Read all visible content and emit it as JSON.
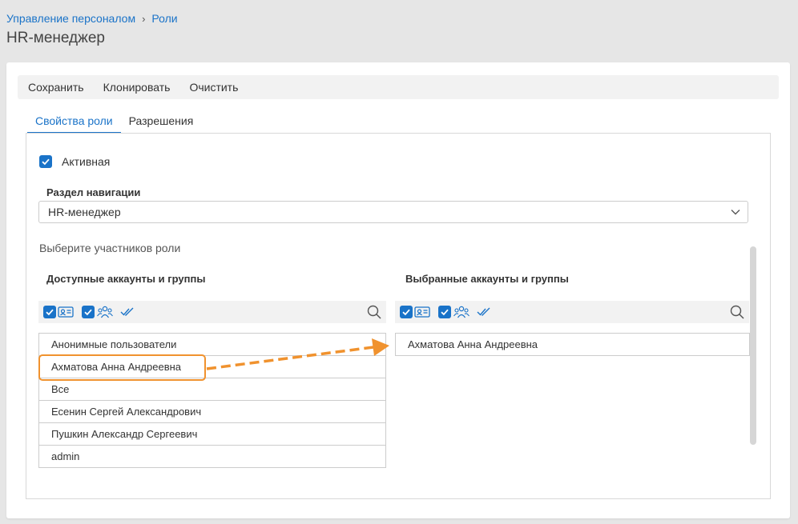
{
  "breadcrumb": {
    "parent": "Управление персоналом",
    "current": "Роли"
  },
  "page_title": "HR-менеджер",
  "toolbar": {
    "save": "Сохранить",
    "clone": "Клонировать",
    "clear": "Очистить"
  },
  "tabs": [
    {
      "label": "Свойства роли",
      "active": true
    },
    {
      "label": "Разрешения",
      "active": false
    }
  ],
  "active_checkbox": {
    "label": "Активная",
    "checked": true
  },
  "nav_section": {
    "label": "Раздел навигации",
    "value": "HR-менеджер"
  },
  "members_hint": "Выберите участников роли",
  "available": {
    "title": "Доступные аккаунты и группы",
    "items": [
      "Анонимные пользователи",
      "Ахматова Анна Андреевна",
      "Все",
      "Есенин Сергей Александрович",
      "Пушкин Александр Сергеевич",
      "admin"
    ]
  },
  "selected": {
    "title": "Выбранные аккаунты и группы",
    "items": [
      "Ахматова Анна Андреевна"
    ]
  },
  "colors": {
    "accent": "#1a73c8",
    "highlight": "#f0922e"
  },
  "icons": {
    "checkbox": "checkmark-icon",
    "user_card": "user-card-icon",
    "group": "group-icon",
    "check_all": "double-check-icon",
    "search": "search-icon",
    "dropdown": "chevron-down-icon"
  }
}
